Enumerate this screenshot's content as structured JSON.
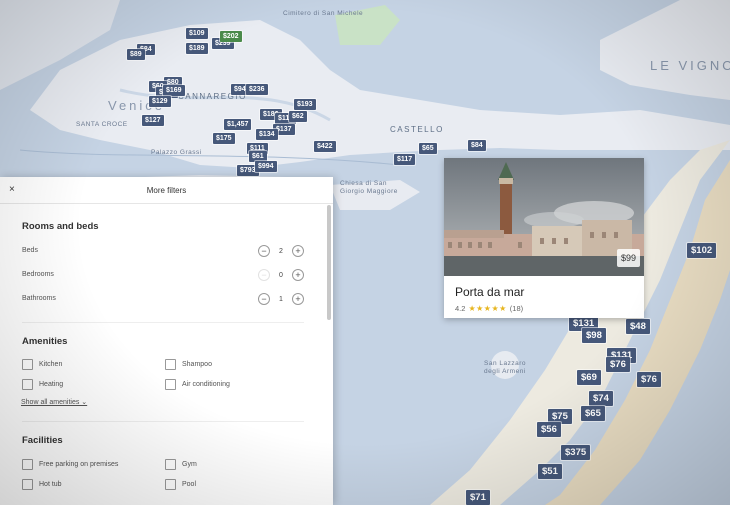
{
  "map": {
    "labels": {
      "cimitero": "Cimitero di San Michele",
      "cannaregio": "CANNAREGIO",
      "venice": "Venice",
      "santa_croce": "SANTA CROCE",
      "castello": "CASTELLO",
      "le_vignole": "LE VIGNOLE",
      "palazzo_grassi": "Palazzo Grassi",
      "chiesa": "Chiesa di San Giorgio Maggiore",
      "san_lazzaro": "San Lazzaro degli Armeni"
    },
    "pins": [
      "$109",
      "$189",
      "$239",
      "$202",
      "$80",
      "$84",
      "$89",
      "$60",
      "$144",
      "$169",
      "$94",
      "$236",
      "$129",
      "$127",
      "$193",
      "$186",
      "$110",
      "$62",
      "$1,457",
      "$137",
      "$175",
      "$134",
      "$111",
      "$61",
      "$793",
      "$994",
      "$422",
      "$117",
      "$65",
      "$84",
      "$102",
      "$131",
      "$98",
      "$48",
      "$131",
      "$76",
      "$69",
      "$76",
      "$74",
      "$75",
      "$65",
      "$56",
      "$375",
      "$51",
      "$71"
    ]
  },
  "card": {
    "price": "$99",
    "title": "Porta da mar",
    "rating": "4.2",
    "stars": "★★★★★",
    "reviews": "(18)"
  },
  "filters": {
    "close": "×",
    "title": "More filters",
    "rooms": {
      "title": "Rooms and beds",
      "beds": {
        "label": "Beds",
        "value": "2"
      },
      "bedrooms": {
        "label": "Bedrooms",
        "value": "0"
      },
      "bathrooms": {
        "label": "Bathrooms",
        "value": "1"
      },
      "minus": "−",
      "plus": "+"
    },
    "amenities": {
      "title": "Amenities",
      "kitchen": "Kitchen",
      "shampoo": "Shampoo",
      "heating": "Heating",
      "ac": "Air conditioning",
      "show_all": "Show all amenities ⌄"
    },
    "facilities": {
      "title": "Facilities",
      "parking": "Free parking on premises",
      "gym": "Gym",
      "hot_tub": "Hot tub",
      "pool": "Pool"
    }
  }
}
